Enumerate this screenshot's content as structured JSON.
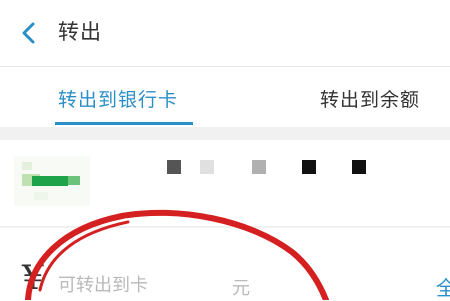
{
  "header": {
    "title": "转出",
    "back_icon": "chevron-left-icon"
  },
  "tabs": [
    {
      "label": "转出到银行卡",
      "active": true
    },
    {
      "label": "转出到余额",
      "active": false
    }
  ],
  "bank_card": {
    "logo": "bank-logo-icon"
  },
  "amount": {
    "currency_symbol": "¥",
    "placeholder": "可转出到卡",
    "unit": "元",
    "all_label": "全"
  },
  "colors": {
    "accent": "#2b8fc7",
    "annotation": "#d42020",
    "bank_logo": "#1ea24a"
  }
}
